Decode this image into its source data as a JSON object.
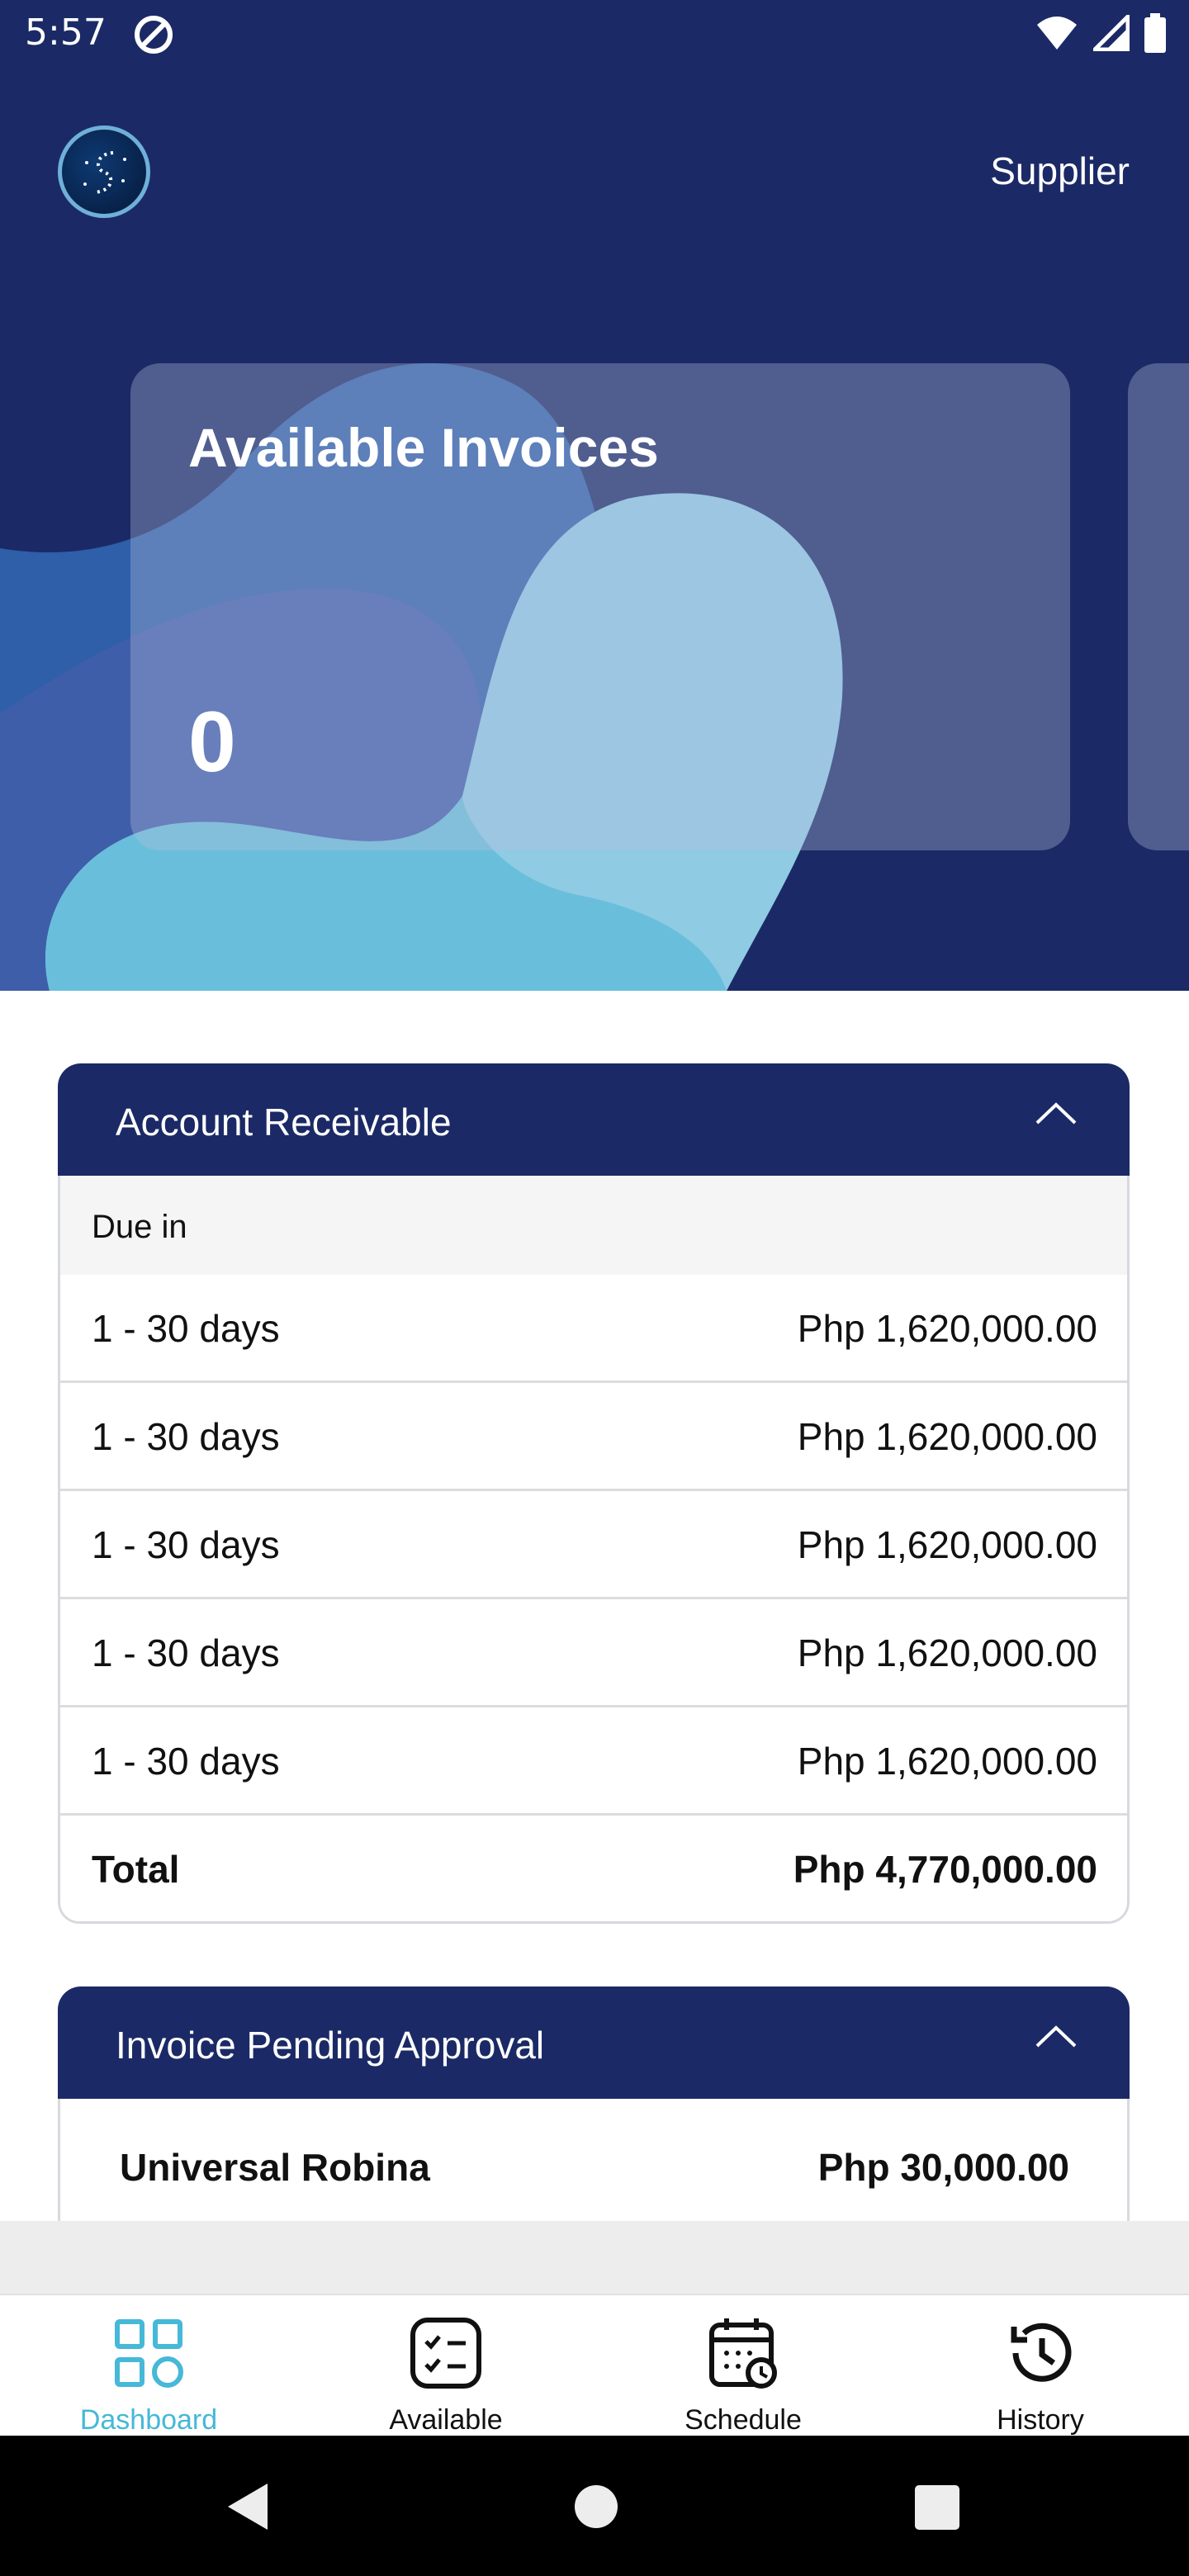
{
  "status_bar": {
    "time": "5:57",
    "icons": [
      "no-disturb-icon",
      "wifi-icon",
      "signal-icon",
      "battery-icon"
    ]
  },
  "header": {
    "role": "Supplier"
  },
  "cards": [
    {
      "title": "Available Invoices",
      "value": "0"
    }
  ],
  "account_receivable": {
    "title": "Account Receivable",
    "due_label": "Due in",
    "rows": [
      {
        "period": "1 - 30 days",
        "amount": "Php 1,620,000.00"
      },
      {
        "period": "1 - 30 days",
        "amount": "Php 1,620,000.00"
      },
      {
        "period": "1 - 30 days",
        "amount": "Php 1,620,000.00"
      },
      {
        "period": "1 - 30 days",
        "amount": "Php 1,620,000.00"
      },
      {
        "period": "1 - 30 days",
        "amount": "Php 1,620,000.00"
      }
    ],
    "total_label": "Total",
    "total_amount": "Php 4,770,000.00"
  },
  "pending": {
    "title": "Invoice Pending Approval",
    "items": [
      {
        "name": "Universal Robina",
        "amount": "Php 30,000.00"
      }
    ]
  },
  "bottom_nav": {
    "items": [
      {
        "label": "Dashboard",
        "icon": "dashboard-grid-icon",
        "active": true
      },
      {
        "label": "Available",
        "icon": "checklist-icon",
        "active": false
      },
      {
        "label": "Schedule",
        "icon": "calendar-clock-icon",
        "active": false
      },
      {
        "label": "History",
        "icon": "history-icon",
        "active": false
      }
    ]
  },
  "colors": {
    "primary": "#1b2a66",
    "accent": "#46b8d8",
    "blob_light": "#8fcbe3",
    "blob_mid": "#5a7fc0"
  }
}
